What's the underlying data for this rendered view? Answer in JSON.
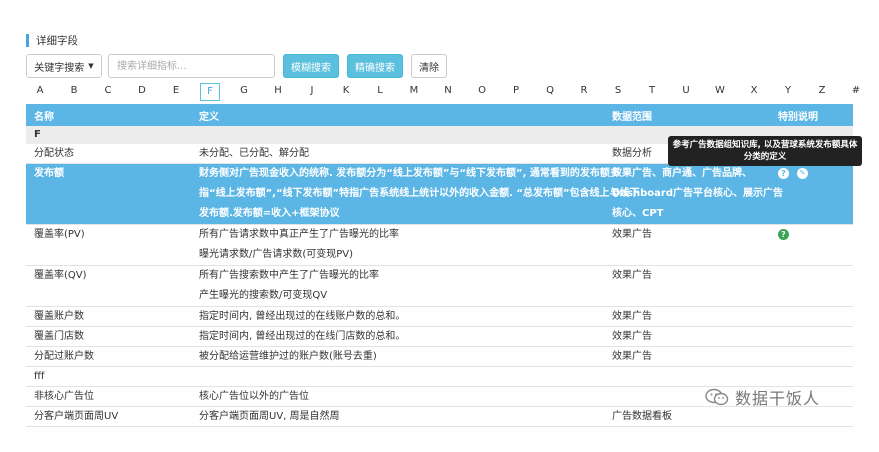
{
  "section_title": "详细字段",
  "toolbar": {
    "dropdown_label": "关键字搜索",
    "search_placeholder": "搜索详细指标...",
    "fuzzy_label": "模糊搜索",
    "exact_label": "精确搜索",
    "clear_label": "清除"
  },
  "alphabet": [
    "A",
    "B",
    "C",
    "D",
    "E",
    "F",
    "G",
    "H",
    "J",
    "K",
    "L",
    "M",
    "N",
    "O",
    "P",
    "Q",
    "R",
    "S",
    "T",
    "U",
    "W",
    "X",
    "Y",
    "Z",
    "#"
  ],
  "active_letter": "F",
  "table": {
    "headers": [
      "名称",
      "定义",
      "数据范围",
      "特别说明"
    ],
    "group_label": "F",
    "rows": [
      {
        "name": "分配状态",
        "definition": [
          "未分配、已分配、解分配"
        ],
        "scope": [
          "数据分析"
        ]
      },
      {
        "name": "发布额",
        "definition": [
          "财务侧对广告现金收入的统称. 发布额分为“线上发布额”与“线下发布额”, 通常看到的发布额多",
          "指“线上发布额”,“线下发布额”特指广告系统线上统计以外的收入金额. “总发布额”包含线上与线下",
          "发布额.发布额=收入+框架协议"
        ],
        "scope": [
          "效果广告、商户通、广告品牌、",
          "Dashboard广告平台核心、展示广告",
          "核心、CPT"
        ]
      },
      {
        "name": "覆盖率(PV)",
        "definition": [
          "所有广告请求数中真正产生了广告曝光的比率",
          "曝光请求数/广告请求数(可变现PV)"
        ],
        "scope": [
          "效果广告"
        ]
      },
      {
        "name": "覆盖率(QV)",
        "definition": [
          "所有广告搜索数中产生了广告曝光的比率",
          "产生曝光的搜索数/可变现QV"
        ],
        "scope": [
          "效果广告"
        ]
      },
      {
        "name": "覆盖账户数",
        "definition": [
          "指定时间内, 曾经出现过的在线账户数的总和。"
        ],
        "scope": [
          "效果广告"
        ]
      },
      {
        "name": "覆盖门店数",
        "definition": [
          "指定时间内, 曾经出现过的在线门店数的总和。"
        ],
        "scope": [
          "效果广告"
        ]
      },
      {
        "name": "分配过账户数",
        "definition": [
          "被分配给运营维护过的账户数(账号去重)"
        ],
        "scope": [
          "效果广告"
        ]
      },
      {
        "name": "fff",
        "definition": [],
        "scope": []
      },
      {
        "name": "非核心广告位",
        "definition": [
          "核心广告位以外的广告位"
        ],
        "scope": []
      },
      {
        "name": "分客户端页面周UV",
        "definition": [
          "分客户端页面周UV, 周是自然周"
        ],
        "scope": [
          "广告数据看板"
        ]
      }
    ]
  },
  "tooltip_text": "参考广告数据组知识库, 以及营球系统发布额具体分类的定义",
  "watermark_text": "数据干饭人",
  "colors": {
    "accent": "#5bb6e6",
    "green": "#3aa655"
  }
}
